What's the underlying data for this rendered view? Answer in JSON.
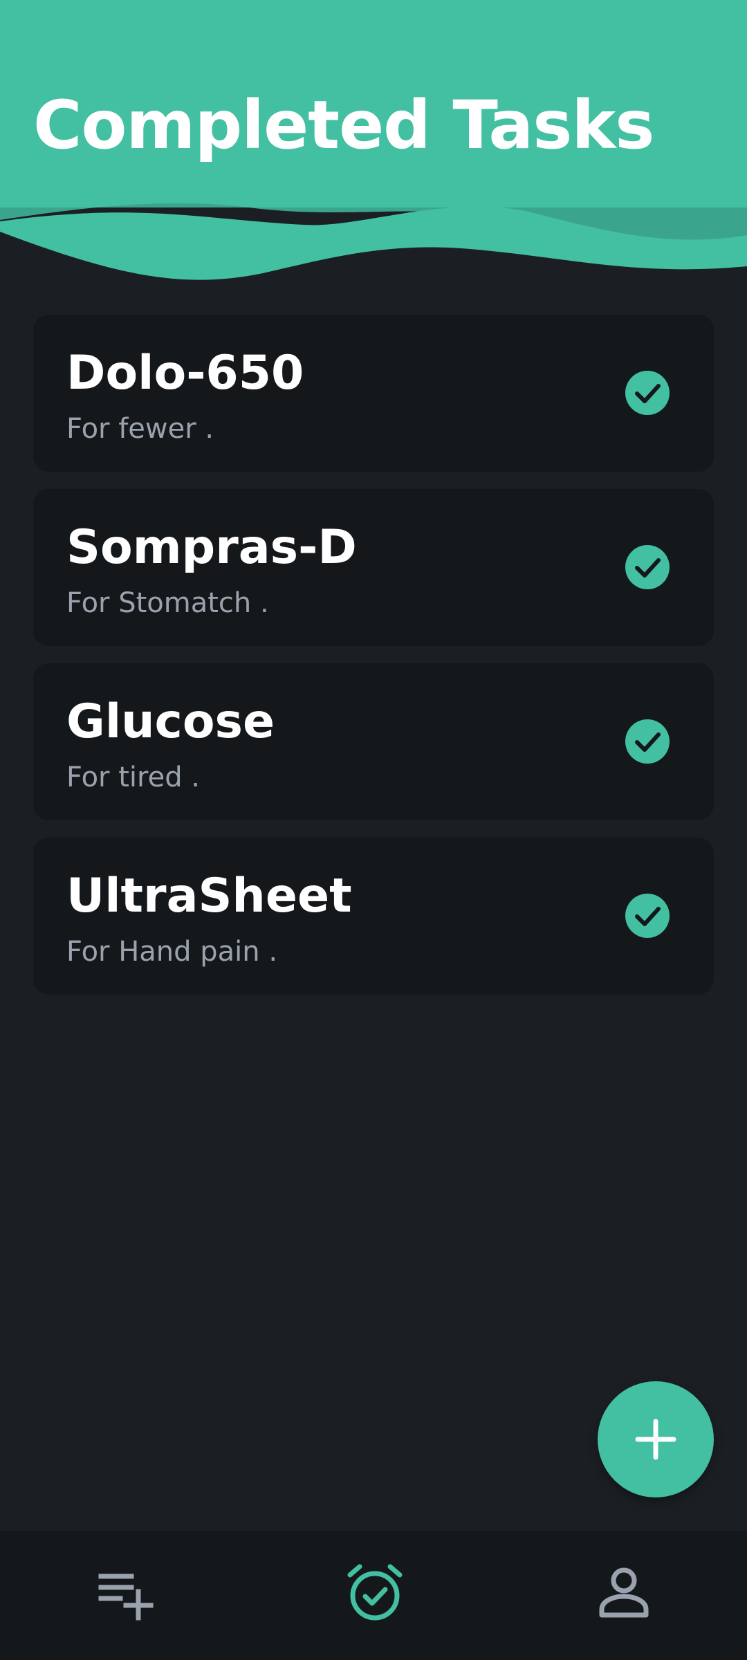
{
  "header": {
    "title": "Completed Tasks"
  },
  "tasks": [
    {
      "name": "Dolo-650",
      "description": "For fewer  ."
    },
    {
      "name": "Sompras-D",
      "description": "For Stomatch  ."
    },
    {
      "name": "Glucose",
      "description": "For tired  ."
    },
    {
      "name": "UltraSheet",
      "description": "For Hand pain  ."
    }
  ],
  "icons": {
    "task_status": "check-circle-icon",
    "fab": "plus-icon",
    "nav": [
      "playlist-add-icon",
      "alarm-check-icon",
      "person-icon"
    ]
  },
  "colors": {
    "accent": "#43bfa2",
    "accent_dark": "#36a88d",
    "background": "#1b1f23",
    "card": "#15181b",
    "nav_inactive": "#9aa3ad"
  }
}
